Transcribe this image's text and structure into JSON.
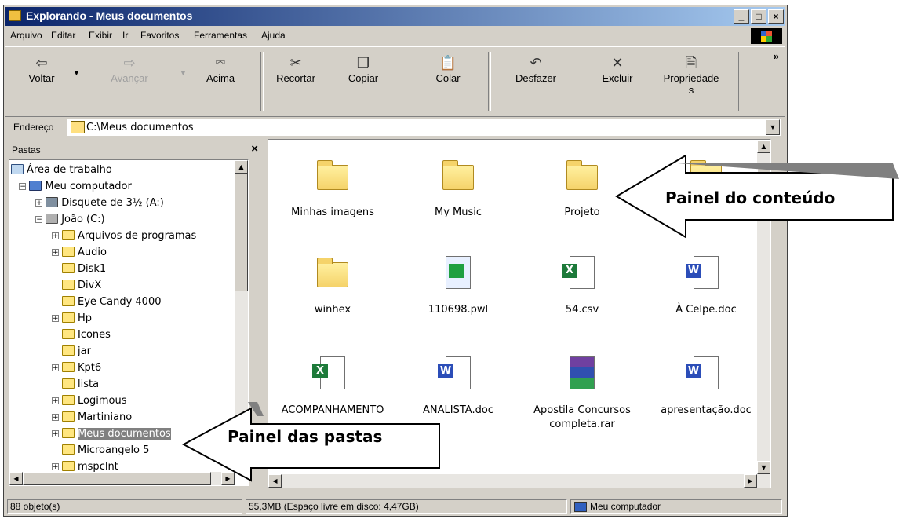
{
  "window": {
    "title": "Explorando - Meus documentos"
  },
  "menu": [
    "Arquivo",
    "Editar",
    "Exibir",
    "Ir",
    "Favoritos",
    "Ferramentas",
    "Ajuda"
  ],
  "toolbar": {
    "back": "Voltar",
    "forward": "Avançar",
    "up": "Acima",
    "cut": "Recortar",
    "copy": "Copiar",
    "paste": "Colar",
    "undo": "Desfazer",
    "delete": "Excluir",
    "properties_1": "Propriedade",
    "properties_2": "s",
    "more": "»"
  },
  "address": {
    "label": "Endereço",
    "value": "C:\\Meus documentos"
  },
  "folders_pane": {
    "title": "Pastas",
    "close": "×"
  },
  "tree": [
    {
      "label": "Área de trabalho",
      "level": 0,
      "expander": ""
    },
    {
      "label": "Meu computador",
      "level": 1,
      "expander": "−"
    },
    {
      "label": "Disquete de 3½ (A:)",
      "level": 2,
      "expander": "+"
    },
    {
      "label": "João (C:)",
      "level": 2,
      "expander": "−"
    },
    {
      "label": "Arquivos de programas",
      "level": 3,
      "expander": "+"
    },
    {
      "label": "Audio",
      "level": 3,
      "expander": "+"
    },
    {
      "label": "Disk1",
      "level": 3,
      "expander": ""
    },
    {
      "label": "DivX",
      "level": 3,
      "expander": ""
    },
    {
      "label": "Eye Candy 4000",
      "level": 3,
      "expander": ""
    },
    {
      "label": "Hp",
      "level": 3,
      "expander": "+"
    },
    {
      "label": "Icones",
      "level": 3,
      "expander": ""
    },
    {
      "label": "jar",
      "level": 3,
      "expander": ""
    },
    {
      "label": "Kpt6",
      "level": 3,
      "expander": "+"
    },
    {
      "label": "lista",
      "level": 3,
      "expander": ""
    },
    {
      "label": "Logimous",
      "level": 3,
      "expander": "+"
    },
    {
      "label": "Martiniano",
      "level": 3,
      "expander": "+"
    },
    {
      "label": "Meus documentos",
      "level": 3,
      "expander": "+"
    },
    {
      "label": "Microangelo 5",
      "level": 3,
      "expander": ""
    },
    {
      "label": "mspclnt",
      "level": 3,
      "expander": "+"
    }
  ],
  "content_items": [
    {
      "label": "Minhas imagens",
      "label2": "",
      "kind": "folder"
    },
    {
      "label": "My Music",
      "label2": "",
      "kind": "folder"
    },
    {
      "label": "Projeto",
      "label2": "",
      "kind": "folder"
    },
    {
      "label": "",
      "label2": "",
      "kind": "folder"
    },
    {
      "label": "winhex",
      "label2": "",
      "kind": "folder"
    },
    {
      "label": "110698.pwl",
      "label2": "",
      "kind": "pwl"
    },
    {
      "label": "54.csv",
      "label2": "",
      "kind": "excel-csv"
    },
    {
      "label": "À Celpe.doc",
      "label2": "",
      "kind": "word"
    },
    {
      "label": "ACOMPANHAMENTO",
      "label2": "",
      "kind": "excel"
    },
    {
      "label": "ANALISTA.doc",
      "label2": "",
      "kind": "word"
    },
    {
      "label": "Apostila Concursos",
      "label2": "completa.rar",
      "kind": "rar"
    },
    {
      "label": "apresentação.doc",
      "label2": "",
      "kind": "word"
    }
  ],
  "callouts": {
    "content": "Painel do conteúdo",
    "folders": "Painel das pastas"
  },
  "status": {
    "objects": "88 objeto(s)",
    "space": "55,3MB (Espaço livre em disco: 4,47GB)",
    "location": "Meu computador"
  },
  "colors": {
    "title_start": "#0a246a",
    "title_end": "#a6caf0",
    "face": "#d4d0c8",
    "excel": "#1d7a3a",
    "word": "#2b4db8"
  }
}
